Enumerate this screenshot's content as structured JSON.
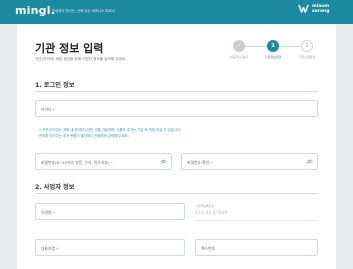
{
  "header": {
    "logo": "mingl.",
    "tagline": "밍글에서 만나는, 신뢰 있는 비즈니스 파트너",
    "brand_name_line1": "miaum",
    "brand_name_line2": "sorang",
    "background_color": "#1b8aa1"
  },
  "page": {
    "title": "기관 정보 입력",
    "description": "기관(관리자) 계정 생성을 위해 사업자 정보를 입력해 주세요."
  },
  "steps": [
    {
      "number": "✓",
      "label": "이용약관 동의",
      "state": "done"
    },
    {
      "number": "2",
      "label": "기관정보입력",
      "state": "active"
    },
    {
      "number": "3",
      "label": "가입신청완료",
      "state": "todo"
    }
  ],
  "login_section": {
    "title": "1. 로그인 정보",
    "id_label": "아이디",
    "hint_line1": "• 기관 아이디는 계정 내 관리자 1인만 사용 가능하며, 사용자 추가는 가입 후 직접 하실 수 있습니다.",
    "hint_line2": "  관리자 아이디는 추후 변경이 불가하니 신중하게 입력해 주세요.",
    "password_label": "비밀번호(8~20자의 영문, 숫자, 특수기호)",
    "password_confirm_label": "비밀번호 확인"
  },
  "business_section": {
    "title": "2. 사업자 정보",
    "org_name_label": "기관명",
    "biz_number_caption": "사업자등록번호",
    "biz_number_placeholder": "123-45-67890",
    "ceo_label": "대표자명",
    "fax_label": "팩스번호"
  },
  "required_mark": "*",
  "accent_color": "#1b8aa1"
}
